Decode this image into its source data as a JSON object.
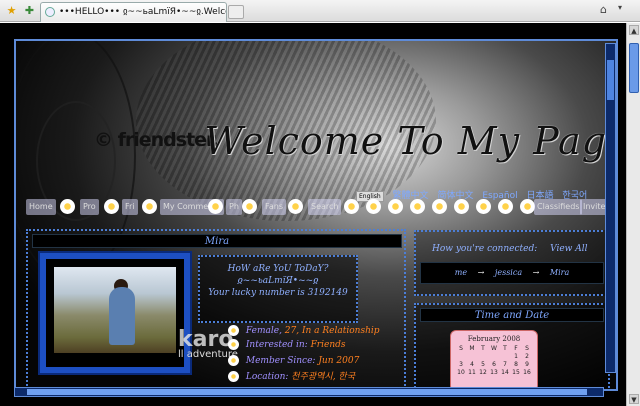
{
  "browser": {
    "tab_title": "•••HELLO••• ჲ~~ьaLmïЯ•~~ჲ.Welcome to m...",
    "toolbar_icons": [
      "star-icon",
      "add-bookmark-icon"
    ],
    "right_icons": [
      "home-icon",
      "menu-dropdown-icon"
    ]
  },
  "header": {
    "brand": "© friendster.",
    "welcome": "Welcome To My Page"
  },
  "languages": [
    "English",
    "繁體中文",
    "简体中文",
    "Español",
    "日本語",
    "한국어"
  ],
  "nav": [
    "Home",
    "Pro",
    "Fri",
    "My Comments",
    "Ph",
    "Fans",
    "Search",
    "Classifieds",
    "Invite"
  ],
  "profile": {
    "name": "Mira",
    "greeting_1": "HoW aRe YoU ToDaY?",
    "greeting_2": "ჲ~~ьaLmïЯ•~~ჲ",
    "lucky_label": "Your lucky number is",
    "lucky_number": "3192149",
    "bg_text_1": "karo",
    "bg_text_2": "ll adventure",
    "info": [
      {
        "label": "Female",
        "value": "27, In a Relationship"
      },
      {
        "label": "Interested in",
        "value": "Friends"
      },
      {
        "label": "Member Since",
        "value": "Jun 2007"
      },
      {
        "label": "Location",
        "value": "천주광역시, 한국"
      }
    ]
  },
  "connection": {
    "title": "How you're connected:",
    "view_all": "View All",
    "chain": [
      "me",
      "→",
      "jessica",
      "→",
      "Mira"
    ]
  },
  "time_date": {
    "title": "Time and Date",
    "calendar_month": "February 2008",
    "weekdays": [
      "S",
      "M",
      "T",
      "W",
      "T",
      "F",
      "S"
    ],
    "rows": [
      [
        "",
        "",
        "",
        "",
        "",
        "1",
        "2"
      ],
      [
        "3",
        "4",
        "5",
        "6",
        "7",
        "8",
        "9"
      ],
      [
        "10",
        "11",
        "12",
        "13",
        "14",
        "15",
        "16"
      ]
    ]
  }
}
